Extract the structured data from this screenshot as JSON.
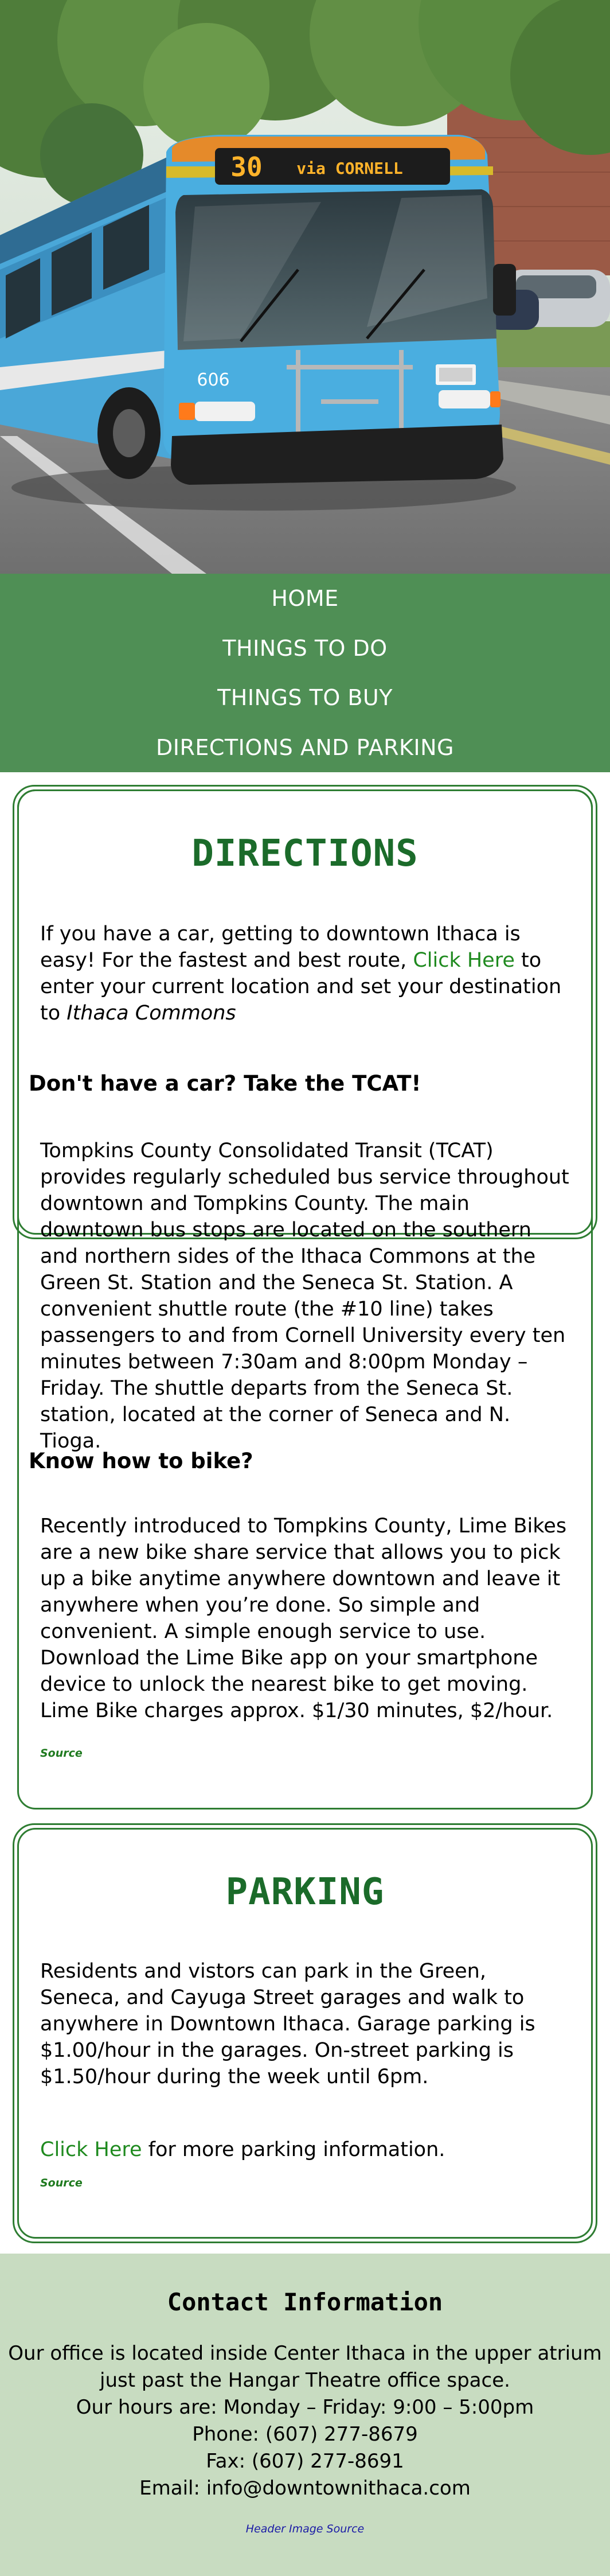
{
  "hero": {
    "bus_route_number": "30",
    "bus_destination": "via CORNELL",
    "bus_fleet_number": "606"
  },
  "nav": {
    "items": [
      {
        "label": "HOME"
      },
      {
        "label": "THINGS TO DO"
      },
      {
        "label": "THINGS TO BUY"
      },
      {
        "label": "DIRECTIONS AND PARKING"
      }
    ]
  },
  "directions": {
    "title": "DIRECTIONS",
    "intro_before": "If you have a car, getting to downtown Ithaca is easy! For the fastest and best route, ",
    "intro_link": "Click Here",
    "intro_after": " to enter your current location and set your destination to ",
    "intro_destination": "Ithaca Commons",
    "tcat_heading": "Don't have a car? Take the TCAT!",
    "tcat_body": "Tompkins County Consolidated Transit (TCAT) provides regularly scheduled bus service throughout downtown and Tompkins County. The main downtown bus stops are located on the southern and northern sides of the Ithaca Commons at the Green St. Station and the Seneca St. Station. A convenient shuttle route (the #10 line) takes passengers to and from Cornell University every ten minutes between 7:30am and 8:00pm Monday – Friday. The shuttle departs from the Seneca St. station, located at the corner of Seneca and N. Tioga.",
    "bike_heading": "Know how to bike?",
    "bike_body": "Recently introduced to Tompkins County, Lime Bikes are a new bike share service that allows you to pick up a bike anytime anywhere downtown and leave it anywhere when you’re done. So simple and convenient. A simple enough service to use. Download the Lime Bike app on your smartphone device to unlock the nearest bike to get moving. Lime Bike charges approx. $1/30 minutes, $2/hour.",
    "source_label": "Source"
  },
  "parking": {
    "title": "PARKING",
    "body": "Residents and vistors can park in the Green, Seneca, and Cayuga Street garages and walk to anywhere in Downtown Ithaca. Garage parking is $1.00/hour in the garages. On-street parking is $1.50/hour during the week until 6pm.",
    "more_link": "Click Here",
    "more_after": " for more parking information.",
    "source_label": "Source"
  },
  "contact": {
    "title": "Contact Information",
    "location_line1": "Our office is located inside Center Ithaca in the upper atrium",
    "location_line2": "just past the Hangar Theatre office space.",
    "hours": "Our hours are: Monday – Friday: 9:00 – 5:00pm",
    "phone": "Phone: (607) 277-8679",
    "fax": "Fax: (607) 277-8691",
    "email": "Email: info@downtownithaca.com",
    "image_source_label": "Header Image Source"
  },
  "colors": {
    "nav_background": "#4f8f55",
    "accent_green": "#1b6b2a",
    "link_green": "#1f8a1f",
    "footer_background": "#c8dcc1",
    "footer_link_blue": "#1a1aa6"
  }
}
